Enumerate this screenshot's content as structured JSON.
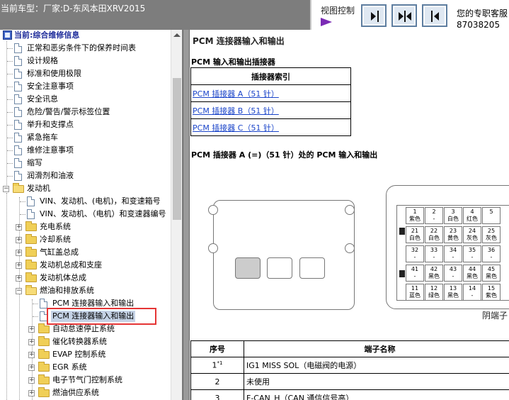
{
  "header": {
    "title": "当前车型：厂家:D-东风本田XRV2015",
    "view_control_label": "视图控制",
    "service_line1": "您的专职客服",
    "service_line2": "87038205"
  },
  "tree": {
    "root": "当前:综合维修信息",
    "items": [
      "正常和恶劣条件下的保养时间表",
      "设计规格",
      "标准和使用极限",
      "安全注意事项",
      "安全讯息",
      "危险/警告/警示标签位置",
      "举升和支撑点",
      "紧急拖车",
      "维修注意事项",
      "缩写",
      "润滑剂和油液"
    ],
    "engine": "发动机",
    "engine_docs": [
      "VIN、发动机、(电机)，和变速箱号",
      "VIN、发动机、（电机）和变速器编号"
    ],
    "engine_folders": [
      "充电系统",
      "冷却系统",
      "气缸盖总成",
      "发动机总成和支座",
      "发动机体总成"
    ],
    "fuel": "燃油和排放系统",
    "fuel_docs": [
      "PCM 连接器输入和输出",
      "PCM 连接器输入和输出"
    ],
    "fuel_folders": [
      "自动怠速停止系统",
      "催化转换器系统",
      "EVAP 控制系统",
      "EGR 系统",
      "电子节气门控制系统",
      "燃油供应系统"
    ]
  },
  "content": {
    "title": "PCM 连接器输入和输出",
    "subtitle1": "PCM 输入和输出插接器",
    "index_header": "插接器索引",
    "index_links": [
      "PCM 插接器 A（51 针）",
      "PCM 插接器 B（51 针）",
      "PCM 插接器 C（51 针）"
    ],
    "subtitle2": "PCM 插接器 A (=)（51 针）处的 PCM 输入和输出",
    "connector_caption": "阴端子",
    "pins": [
      {
        "n": "1",
        "c": "紫色"
      },
      {
        "n": "2",
        "c": "-"
      },
      {
        "n": "3",
        "c": "白色"
      },
      {
        "n": "4",
        "c": "红色"
      },
      {
        "n": "5",
        "c": ""
      },
      {
        "n": "21",
        "c": "白色"
      },
      {
        "n": "22",
        "c": "白色"
      },
      {
        "n": "23",
        "c": "黄色"
      },
      {
        "n": "24",
        "c": "灰色"
      },
      {
        "n": "25",
        "c": "灰色"
      },
      {
        "n": "32",
        "c": "-"
      },
      {
        "n": "33",
        "c": "-"
      },
      {
        "n": "34",
        "c": "-"
      },
      {
        "n": "35",
        "c": "-"
      },
      {
        "n": "36",
        "c": "-"
      },
      {
        "n": "41",
        "c": "-"
      },
      {
        "n": "42",
        "c": "黑色"
      },
      {
        "n": "43",
        "c": "-"
      },
      {
        "n": "44",
        "c": "黑色"
      },
      {
        "n": "45",
        "c": "黑色"
      },
      {
        "n": "11",
        "c": "蓝色"
      },
      {
        "n": "12",
        "c": "绿色"
      },
      {
        "n": "13",
        "c": "黑色"
      },
      {
        "n": "14",
        "c": "-"
      },
      {
        "n": "15",
        "c": "紫色"
      }
    ],
    "table_headers": [
      "序号",
      "端子名称"
    ],
    "table_rows": [
      {
        "num": "1",
        "sup": "*1",
        "name": "IG1 MISS SOL（电磁阀的电源）"
      },
      {
        "num": "2",
        "sup": "",
        "name": "未使用"
      },
      {
        "num": "3",
        "sup": "",
        "name": "F-CAN_H（CAN 通信信号高）"
      }
    ]
  },
  "colors": {
    "header_bg": "#7d7d7d",
    "link": "#1a44c9",
    "highlight": "#e53535",
    "selected": "#c5d3e6"
  }
}
